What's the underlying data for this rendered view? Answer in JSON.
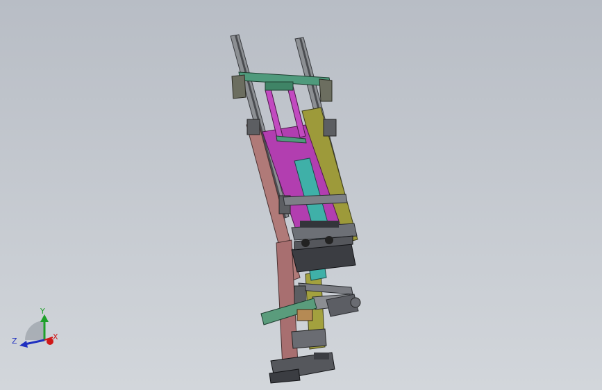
{
  "viewport": {
    "background_top": "#b7bcc4",
    "background_bottom": "#cfd3d8"
  },
  "model": {
    "icon": "cad-assembly-model",
    "colors": {
      "rail": "#8c8f93",
      "rail_dark": "#4a4c50",
      "top_bracket": "#4f9a7c",
      "magenta_plate": "#b23eb0",
      "olive_plate": "#9d9a3a",
      "salmon_frame": "#b07a78",
      "cyan_block": "#3fb0a8",
      "dark_parts": "#3b3d42",
      "green_arm": "#5a9c7c",
      "tan_part": "#b58a54"
    }
  },
  "triad": {
    "icon": "coordinate-triad-icon",
    "y_label": "Y",
    "z_label": "Z",
    "x_label": "X",
    "y_color": "#1ea02a",
    "z_color": "#2030c0",
    "x_color": "#d01818"
  }
}
